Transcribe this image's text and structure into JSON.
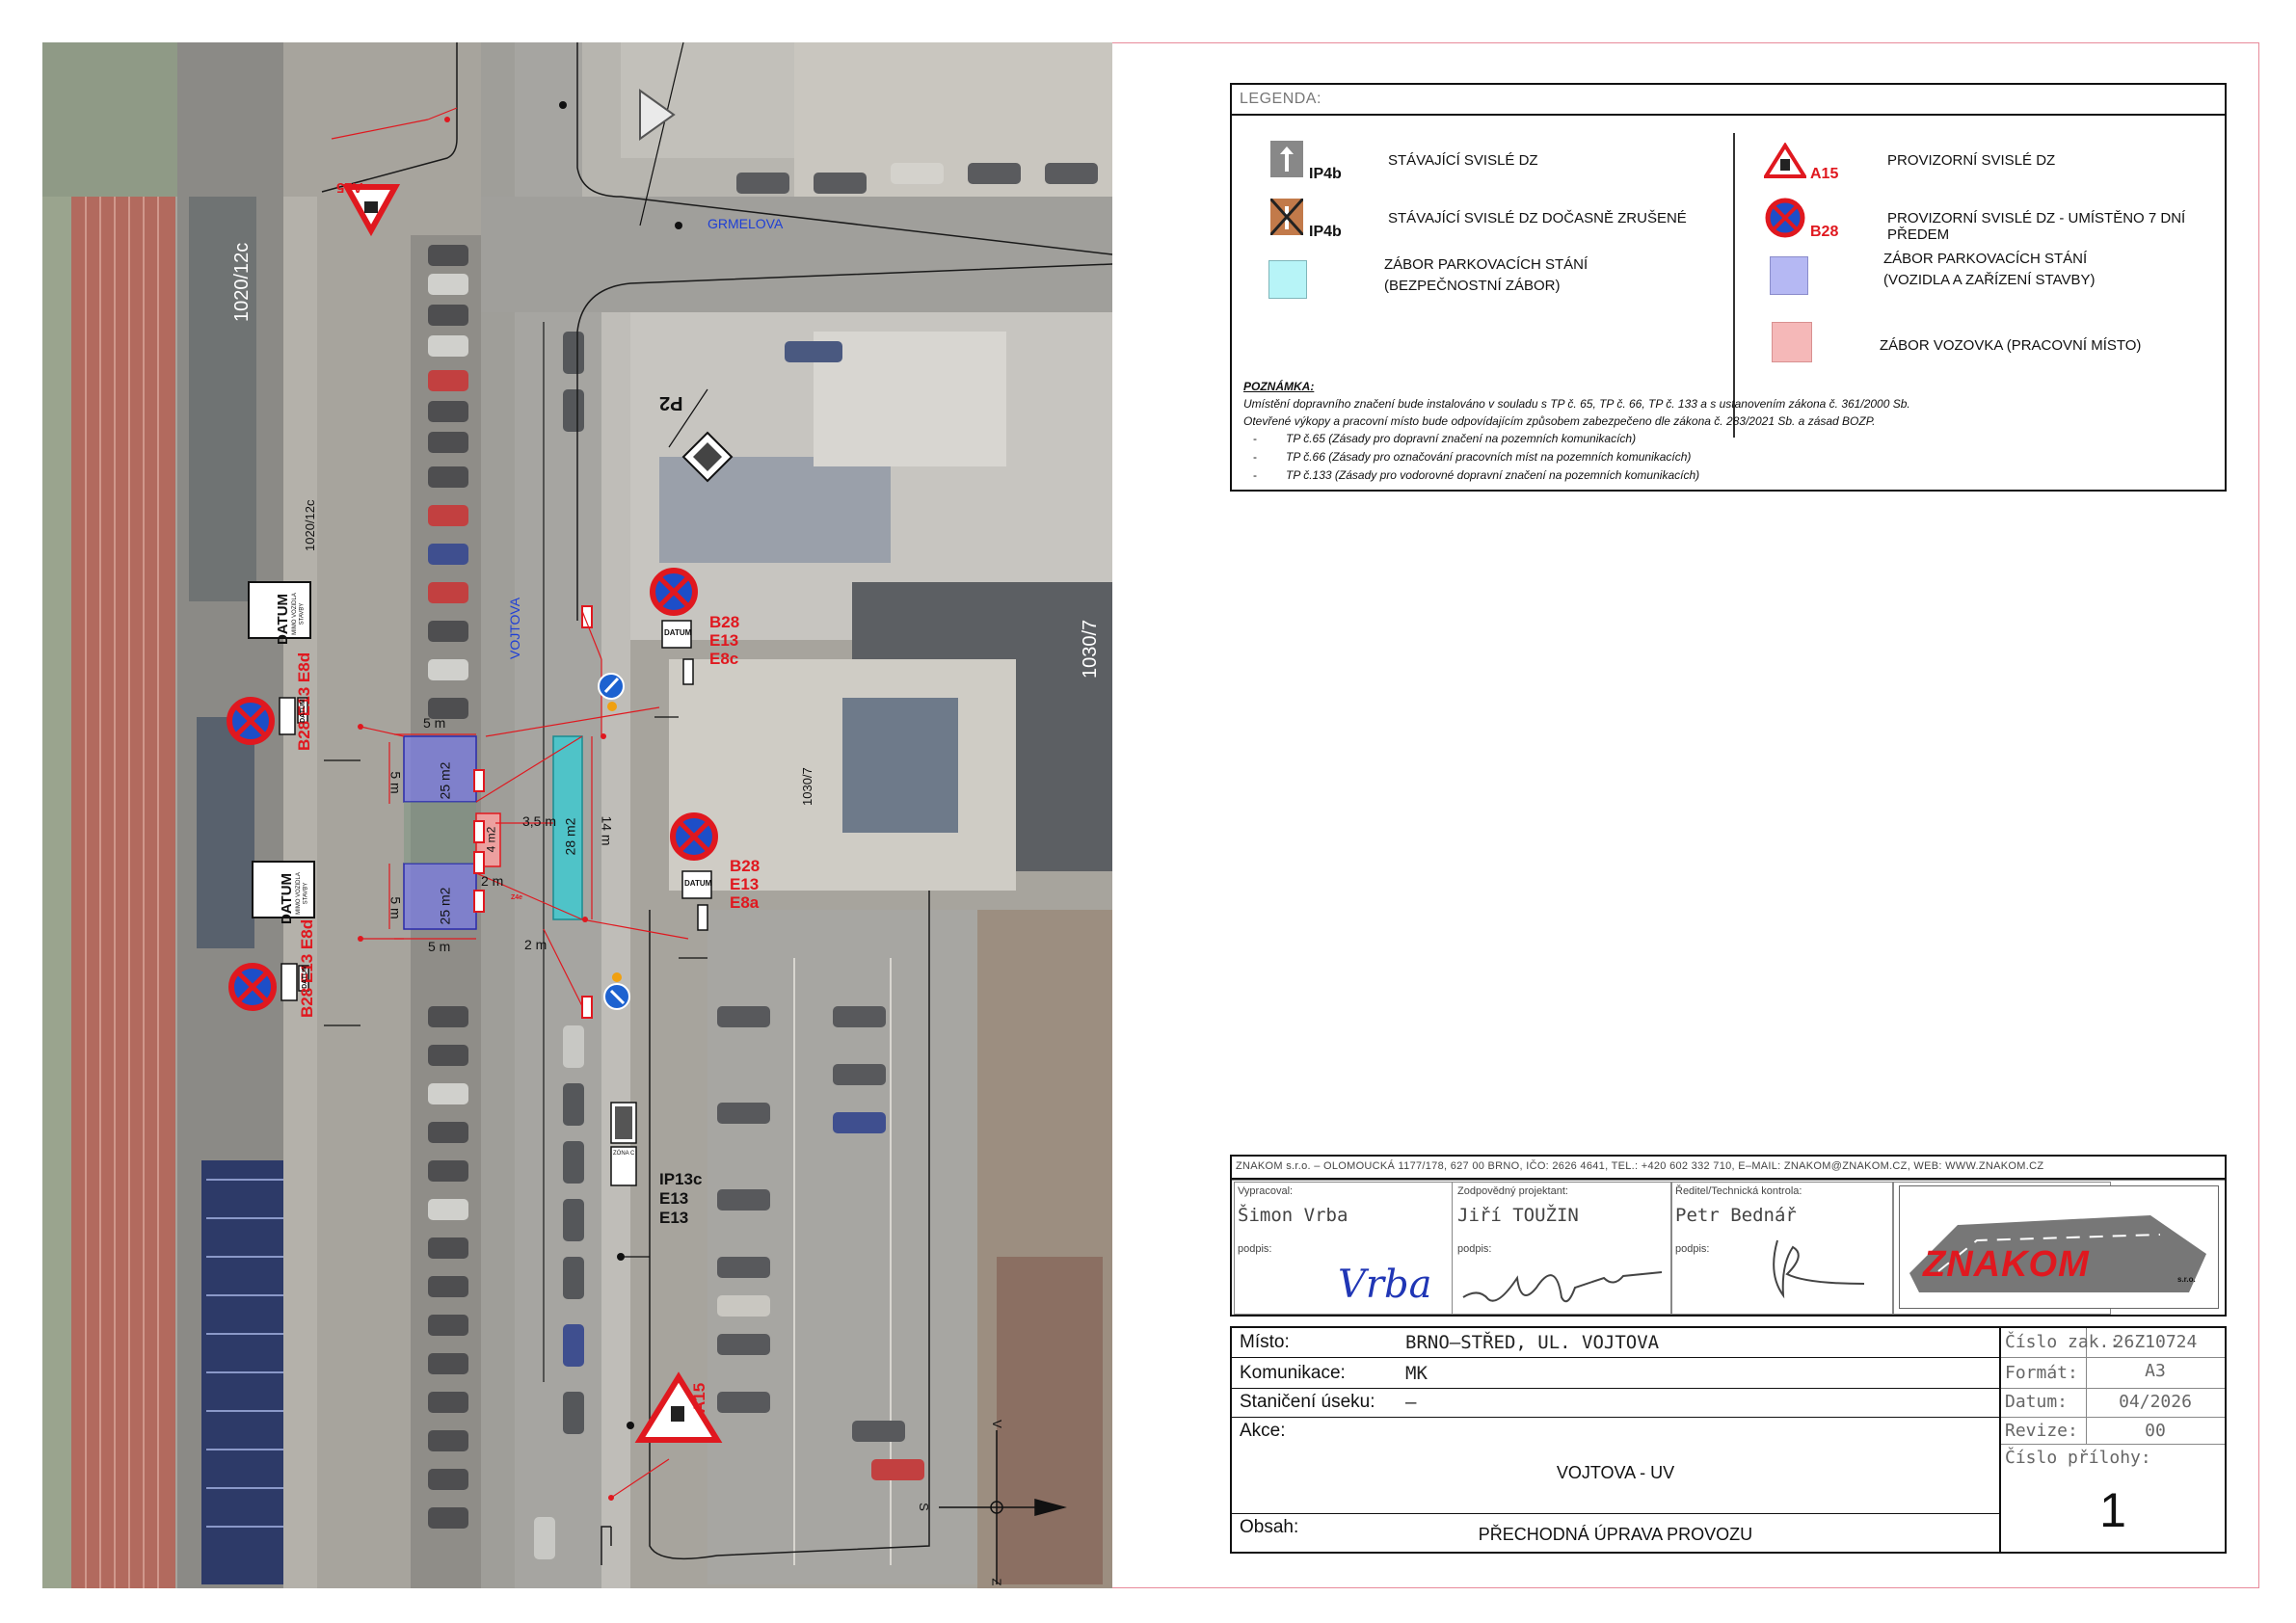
{
  "map": {
    "street_grmelova": "GRMELOVA",
    "street_vojtova": "VOJTOVA",
    "parcel_1020_12c_top": "1020/12c",
    "parcel_1020_12c": "1020/12c",
    "parcel_1030_7_top": "1030/7",
    "parcel_1030_7": "1030/7",
    "sign_a15_top": "A15",
    "sign_p2": "P2",
    "group_right_top": {
      "codes": [
        "B28",
        "E13",
        "E8c"
      ],
      "datum": "DATUM"
    },
    "group_right_mid": {
      "codes": [
        "B28",
        "E13",
        "E8a"
      ],
      "datum": "DATUM"
    },
    "group_left_top": {
      "codes": [
        "B28",
        "E13",
        "E8d"
      ],
      "datum": "DATUM",
      "board_main": "DATUM",
      "board_sub1": "MIMO VOZIDLA",
      "board_sub2": "STAVBY"
    },
    "group_left_bottom": {
      "codes": [
        "B28",
        "E13",
        "E8d"
      ],
      "datum": "DATUM",
      "board_main": "DATUM",
      "board_sub1": "MIMO VOZIDLA",
      "board_sub2": "STAVBY"
    },
    "group_parking": {
      "codes": [
        "IP13c",
        "E13",
        "E13"
      ],
      "zone": "ZÓNA C"
    },
    "sign_a15_bottom": "A15",
    "dims": {
      "d5m_top": "5 m",
      "d5m_left_top": "5 m",
      "area_top": "25 m2",
      "d3_5m": "3,5 m",
      "area_mid": "4 m2",
      "d2m_a": "2 m",
      "area_teal": "28 m2",
      "d14m": "14 m",
      "d5m_left_bottom": "5 m",
      "area_bottom": "25 m2",
      "d2m_b": "2 m",
      "d5m_bottom": "5 m",
      "z4e": "Z4e"
    },
    "compass": {
      "s": "S",
      "v": "V",
      "z": "Z"
    }
  },
  "legend": {
    "title": "LEGENDA:",
    "items": {
      "existing_code": "IP4b",
      "existing_label": "STÁVAJÍCÍ SVISLÉ DZ",
      "cancelled_code": "IP4b",
      "cancelled_label": "STÁVAJÍCÍ SVISLÉ DZ DOČASNĚ ZRUŠENÉ",
      "security_line1": "ZÁBOR PARKOVACÍCH STÁNÍ",
      "security_line2": "(BEZPEČNOSTNÍ ZÁBOR)",
      "temp_code": "A15",
      "temp_label": "PROVIZORNÍ SVISLÉ DZ",
      "temp7_code": "B28",
      "temp7_label": "PROVIZORNÍ SVISLÉ DZ - UMÍSTĚNO 7 DNÍ PŘEDEM",
      "vehicles_line1": "ZÁBOR PARKOVACÍCH STÁNÍ",
      "vehicles_line2": "(VOZIDLA A ZAŘÍZENÍ STAVBY)",
      "road_label": "ZÁBOR VOZOVKA (PRACOVNÍ MÍSTO)"
    },
    "colors": {
      "security": "#b7f4f7",
      "vehicles": "#b5b8f3",
      "road": "#f5b8b8",
      "accent_red": "#e0181f"
    },
    "note_title": "POZNÁMKA:",
    "note_line1": "Umístění dopravního značení bude instalováno v souladu s  TP č. 65, TP č. 66, TP č. 133 a s ustanovením zákona č. 361/2000 Sb.",
    "note_line2": "Otevřené výkopy a pracovní místo bude odpovídajícím způsobem zabezpečeno dle zákona č. 283/2021 Sb. a zásad BOZP.",
    "note_items": [
      "TP č.65 (Zásady pro dopravní značení na pozemních komunikacích)",
      "TP č.66 (Zásady pro označování pracovních míst na pozemních komunikacích)",
      "TP č.133 (Zásady pro vodorovné dopravní značení na pozemních komunikacích)"
    ],
    "dash": "-"
  },
  "company": {
    "header": "ZNAKOM s.r.o. – OLOMOUCKÁ 1177/178, 627 00 BRNO, IČO: 2626 4641, TEL.: +420 602 332 710, E–MAIL: ZNAKOM@ZNAKOM.CZ, WEB: WWW.ZNAKOM.CZ",
    "col1_label": "Vypracoval:",
    "col1_name": "Šimon Vrba",
    "col2_label": "Zodpovědný projektant:",
    "col2_name": "Jiří TOUŽIN",
    "col3_label": "Ředitel/Technická kontrola:",
    "col3_name": "Petr Bednář",
    "sign_label": "podpis:",
    "signature1": "Vrba",
    "logo_text": "ZNAKOM",
    "logo_sub": "s.r.o."
  },
  "titleblock": {
    "misto_label": "Místo:",
    "misto_value": "BRNO–STŘED, UL. VOJTOVA",
    "komunikace_label": "Komunikace:",
    "komunikace_value": "MK",
    "staniceni_label": "Staničení úseku:",
    "staniceni_value": "–",
    "akce_label": "Akce:",
    "akce_value": "VOJTOVA - UV",
    "obsah_label": "Obsah:",
    "obsah_value": "PŘECHODNÁ ÚPRAVA PROVOZU",
    "cislo_zak_label": "Číslo zak.:",
    "cislo_zak_value": "26Z10724",
    "format_label": "Formát:",
    "format_value": "A3",
    "datum_label": "Datum:",
    "datum_value": "04/2026",
    "revize_label": "Revize:",
    "revize_value": "00",
    "cislo_prilohy_label": "Číslo přílohy:",
    "cislo_prilohy_value": "1"
  }
}
